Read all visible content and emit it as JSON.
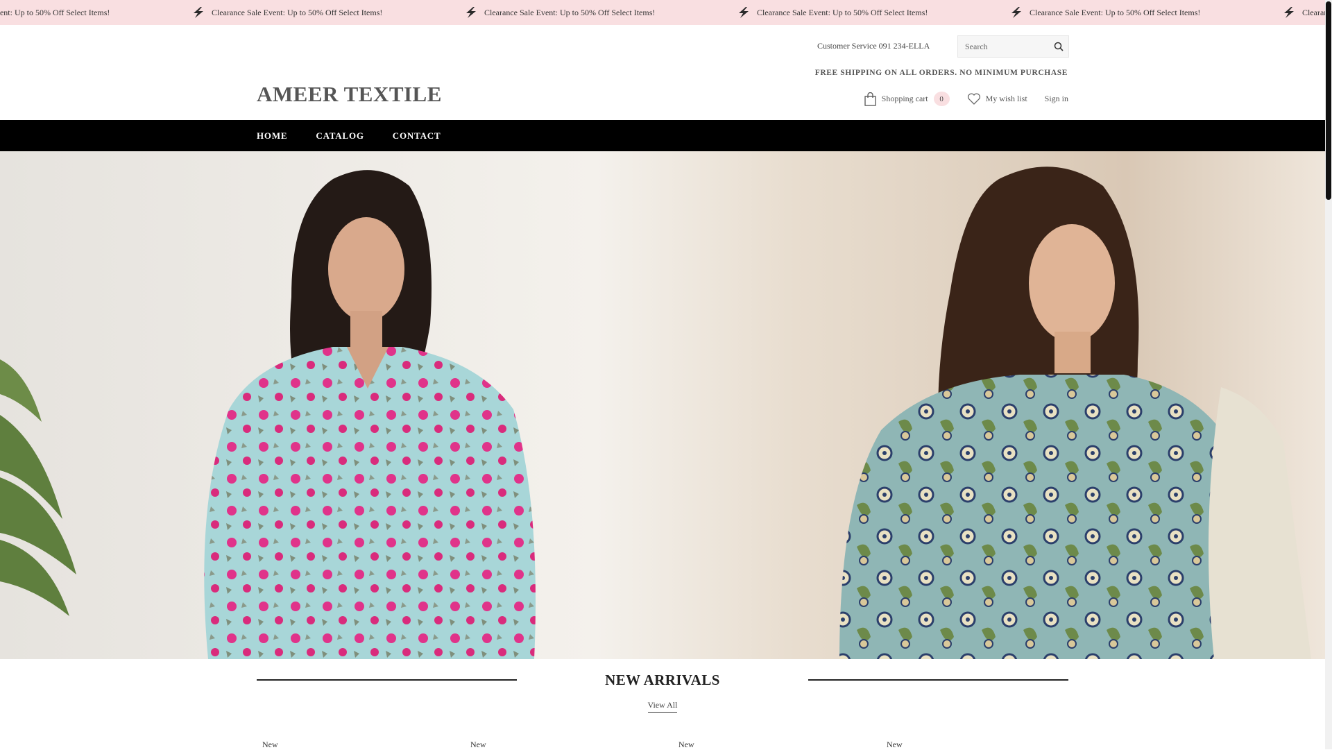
{
  "announcement": {
    "text": "Clearance Sale Event: Up to 50% Off Select Items!",
    "icon": "lightning-icon",
    "background": "#f9dfe1"
  },
  "header": {
    "logo": "AMEER TEXTILE",
    "customer_service": "Customer Service 091 234-ELLA",
    "search_placeholder": "Search",
    "free_shipping": "FREE SHIPPING ON ALL ORDERS. NO MINIMUM PURCHASE",
    "cart_label": "Shopping cart",
    "cart_count": "0",
    "wishlist_label": "My wish list",
    "signin_label": "Sign in"
  },
  "nav": {
    "items": [
      "HOME",
      "CATALOG",
      "CONTACT"
    ]
  },
  "section": {
    "title": "NEW ARRIVALS",
    "view_all": "View All",
    "product_labels": [
      "New",
      "New",
      "New",
      "New"
    ]
  },
  "colors": {
    "nav_bg": "#000000",
    "badge_bg": "#f9dfe1"
  }
}
